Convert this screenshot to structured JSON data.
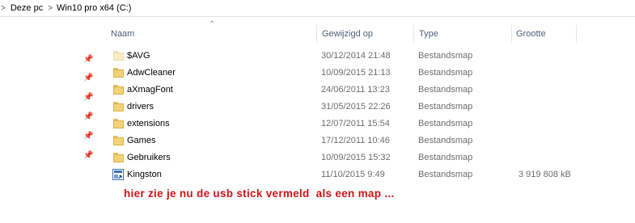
{
  "breadcrumb": {
    "separator": ">",
    "items": [
      "Deze pc",
      "Win10 pro x64  (C:)"
    ]
  },
  "columns": {
    "name": "Naam",
    "modified": "Gewijzigd op",
    "type": "Type",
    "size": "Grootte"
  },
  "rows": [
    {
      "name": "$AVG",
      "modified": "30/12/2014 21:48",
      "type": "Bestandsmap",
      "size": "",
      "icon": "folder-icon-hidden"
    },
    {
      "name": "AdwCleaner",
      "modified": "10/09/2015 21:13",
      "type": "Bestandsmap",
      "size": "",
      "icon": "folder-icon"
    },
    {
      "name": "aXmagFont",
      "modified": "24/06/2011 13:23",
      "type": "Bestandsmap",
      "size": "",
      "icon": "folder-icon"
    },
    {
      "name": "drivers",
      "modified": "31/05/2015 22:26",
      "type": "Bestandsmap",
      "size": "",
      "icon": "folder-icon"
    },
    {
      "name": "extensions",
      "modified": "12/07/2011 15:54",
      "type": "Bestandsmap",
      "size": "",
      "icon": "folder-icon"
    },
    {
      "name": "Games",
      "modified": "17/12/2011 10:46",
      "type": "Bestandsmap",
      "size": "",
      "icon": "folder-icon"
    },
    {
      "name": "Gebruikers",
      "modified": "10/09/2015 15:32",
      "type": "Bestandsmap",
      "size": "",
      "icon": "folder-icon"
    },
    {
      "name": "Kingston",
      "modified": "11/10/2015 9:49",
      "type": "Bestandsmap",
      "size": "3 919 808 kB",
      "icon": "shortcut-icon"
    }
  ],
  "annotation": "hier zie je nu de usb stick vermeld  als een map ...",
  "colors": {
    "annotation": "#d0141a",
    "column_header": "#4c607a",
    "folder": "#f3d27a",
    "secondary_text": "#6d6d6d"
  }
}
